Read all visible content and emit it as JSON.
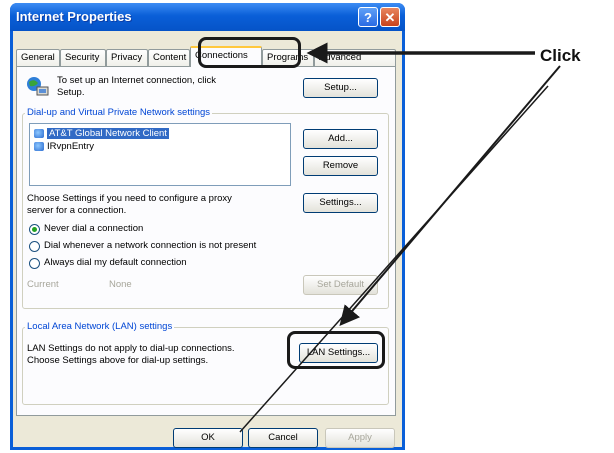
{
  "window": {
    "title": "Internet Properties",
    "help_glyph": "?",
    "close_glyph": "✕"
  },
  "tabs": [
    {
      "label": "General",
      "active": false
    },
    {
      "label": "Security",
      "active": false
    },
    {
      "label": "Privacy",
      "active": false
    },
    {
      "label": "Content",
      "active": false
    },
    {
      "label": "Connections",
      "active": true
    },
    {
      "label": "Programs",
      "active": false
    },
    {
      "label": "Advanced",
      "active": false
    }
  ],
  "setup": {
    "text_line1": "To set up an Internet connection, click",
    "text_line2": "Setup.",
    "button": "Setup..."
  },
  "dialup": {
    "legend": "Dial-up and Virtual Private Network settings",
    "items": [
      "AT&T Global Network Client",
      "IRvpnEntry"
    ],
    "selected_index": 0,
    "add_button": "Add...",
    "remove_button": "Remove",
    "settings_button": "Settings...",
    "proxy_text_line1": "Choose Settings if you need to configure a proxy",
    "proxy_text_line2": "server for a connection.",
    "radio_options": [
      "Never dial a connection",
      "Dial whenever a network connection is not present",
      "Always dial my default connection"
    ],
    "radio_selected_index": 0,
    "current_label": "Current",
    "current_value": "None",
    "set_default_button": "Set Default"
  },
  "lan": {
    "legend": "Local Area Network (LAN) settings",
    "text_line1": "LAN Settings do not apply to dial-up connections.",
    "text_line2": "Choose Settings above for dial-up settings.",
    "button": "LAN Settings..."
  },
  "footer": {
    "ok": "OK",
    "cancel": "Cancel",
    "apply": "Apply"
  },
  "annotation": {
    "label": "Click",
    "color": "#1a1a1a"
  },
  "colors": {
    "titlebar": "#0a5fd8",
    "dialog_bg": "#ece9d8",
    "panel_bg": "#fcfcfe",
    "selection": "#316ac5",
    "group_legend": "#0046d5"
  }
}
